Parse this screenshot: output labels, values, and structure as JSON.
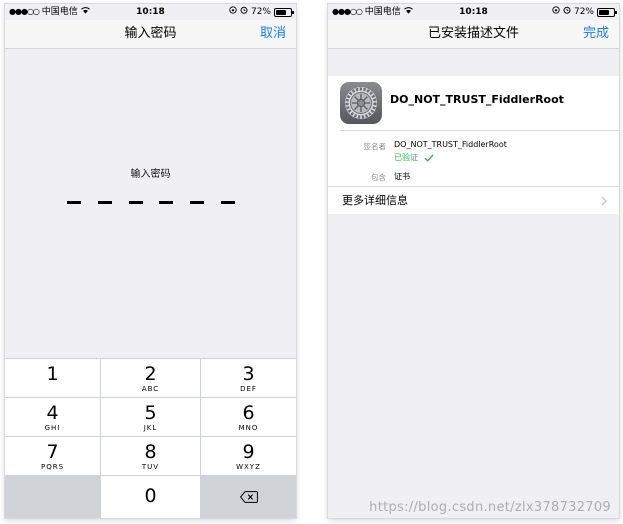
{
  "status": {
    "signal": "●●●○○",
    "carrier": "中国电信",
    "time": "10:18",
    "battery": "72%",
    "battery_level": 0.72
  },
  "left": {
    "nav_title": "输入密码",
    "cancel_label": "取消",
    "prompt": "输入密码",
    "passcode_length": 6,
    "keys": [
      {
        "digit": "1",
        "letters": ""
      },
      {
        "digit": "2",
        "letters": "ABC"
      },
      {
        "digit": "3",
        "letters": "DEF"
      },
      {
        "digit": "4",
        "letters": "GHI"
      },
      {
        "digit": "5",
        "letters": "JKL"
      },
      {
        "digit": "6",
        "letters": "MNO"
      },
      {
        "digit": "7",
        "letters": "PQRS"
      },
      {
        "digit": "8",
        "letters": "TUV"
      },
      {
        "digit": "9",
        "letters": "WXYZ"
      },
      {
        "digit": "0",
        "letters": ""
      }
    ],
    "delete_icon": "backspace-icon"
  },
  "right": {
    "nav_title": "已安装描述文件",
    "done_label": "完成",
    "profile_icon": "settings-gear-icon",
    "profile_name": "DO_NOT_TRUST_FiddlerRoot",
    "signer_label": "签名者",
    "signer_value": "DO_NOT_TRUST_FiddlerRoot",
    "verified_label": "已验证",
    "contains_label": "包含",
    "contains_value": "证书",
    "more_details_label": "更多详细信息"
  },
  "watermark": "https://blog.csdn.net/zlx378732709",
  "colors": {
    "accent": "#1a7cf5",
    "verified": "#2fb84a",
    "background": "#efeff4"
  }
}
